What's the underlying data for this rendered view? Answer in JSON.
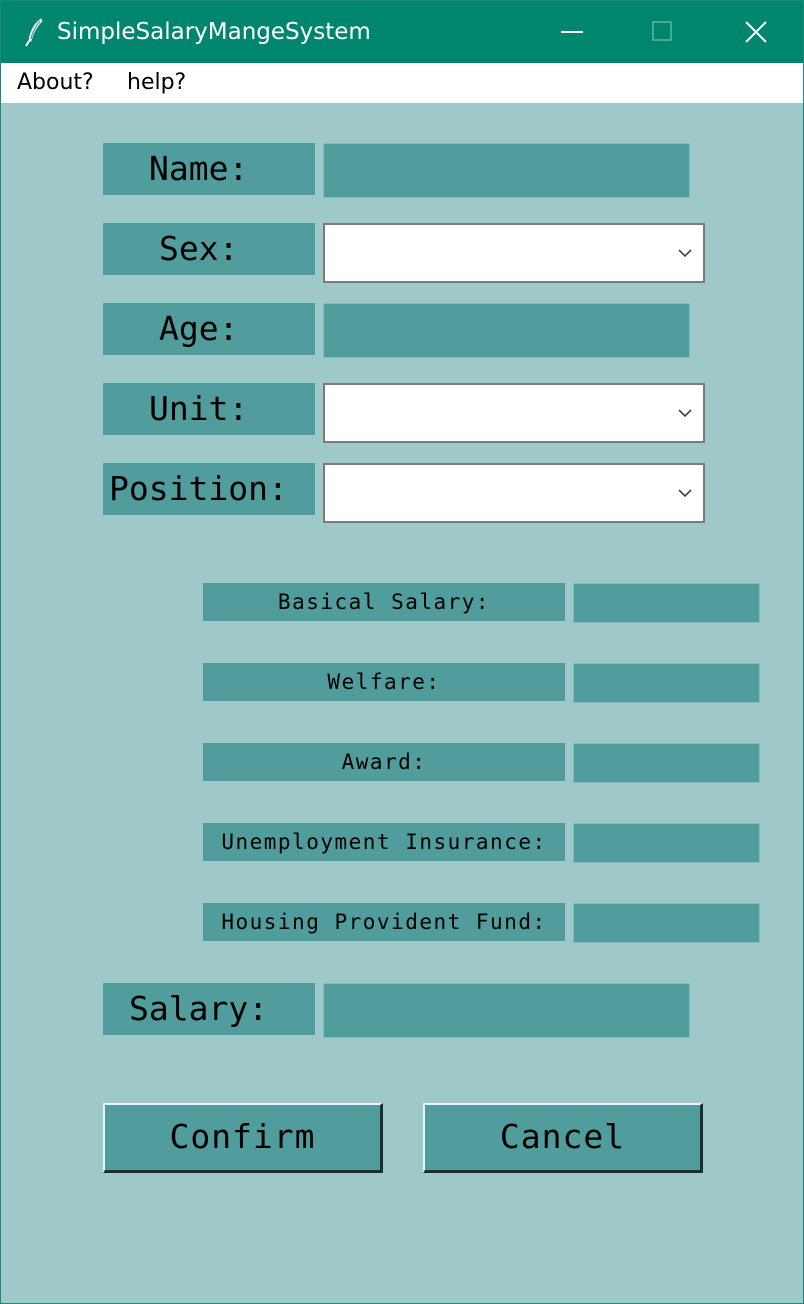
{
  "window": {
    "title": "SimpleSalaryMangeSystem",
    "colors": {
      "titlebar": "#00856f",
      "background": "#9fc9c9",
      "field": "#519c9c"
    }
  },
  "menu": {
    "about": "About?",
    "help": "help?"
  },
  "form": {
    "name_label": "Name:",
    "sex_label": "Sex:",
    "age_label": "Age:",
    "unit_label": "Unit:",
    "position_label": "Position:",
    "name_value": "",
    "sex_value": "",
    "age_value": "",
    "unit_value": "",
    "position_value": "",
    "basical_salary_label": "Basical Salary:",
    "welfare_label": "Welfare:",
    "award_label": "Award:",
    "unemployment_insurance_label": "Unemployment Insurance:",
    "housing_provident_fund_label": "Housing Provident Fund:",
    "basical_salary_value": "",
    "welfare_value": "",
    "award_value": "",
    "unemployment_insurance_value": "",
    "housing_provident_fund_value": "",
    "salary_label": "Salary:",
    "salary_value": ""
  },
  "buttons": {
    "confirm": "Confirm",
    "cancel": "Cancel"
  },
  "icons": {
    "app": "feather-icon",
    "minimize": "minimize-icon",
    "maximize": "maximize-icon",
    "close": "close-icon",
    "dropdown": "chevron-down-icon"
  }
}
